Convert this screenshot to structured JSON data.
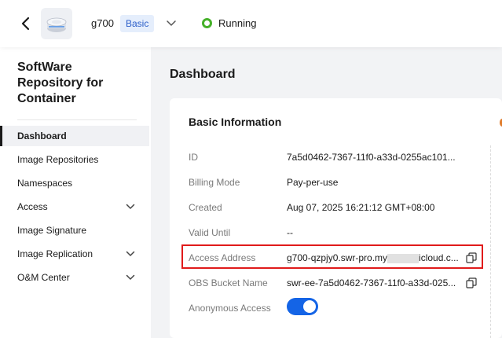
{
  "header": {
    "instance_name": "g700",
    "edition_badge": "Basic",
    "status": "Running",
    "status_color": "#46b12a"
  },
  "sidebar": {
    "title": "SoftWare Repository for Container",
    "items": [
      {
        "label": "Dashboard",
        "active": true
      },
      {
        "label": "Image Repositories"
      },
      {
        "label": "Namespaces"
      },
      {
        "label": "Access",
        "expandable": true
      },
      {
        "label": "Image Signature"
      },
      {
        "label": "Image Replication",
        "expandable": true
      },
      {
        "label": "O&M Center",
        "expandable": true
      }
    ]
  },
  "main": {
    "title": "Dashboard",
    "card_title": "Basic Information",
    "rows": [
      {
        "label": "ID",
        "value": "7a5d0462-7367-11f0-a33d-0255ac101..."
      },
      {
        "label": "Billing Mode",
        "value": "Pay-per-use"
      },
      {
        "label": "Created",
        "value": "Aug 07, 2025 16:21:12 GMT+08:00"
      },
      {
        "label": "Valid Until",
        "value": "--"
      },
      {
        "label": "Access Address",
        "value_prefix": "g700-qzpjy0.swr-pro.my",
        "value_suffix": "icloud.c..."
      },
      {
        "label": "OBS Bucket Name",
        "value": "swr-ee-7a5d0462-7367-11f0-a33d-025..."
      },
      {
        "label": "Anonymous Access",
        "toggle_on": true
      }
    ]
  },
  "colors": {
    "accent": "#1464e6",
    "highlight_border": "#e01b1b"
  }
}
